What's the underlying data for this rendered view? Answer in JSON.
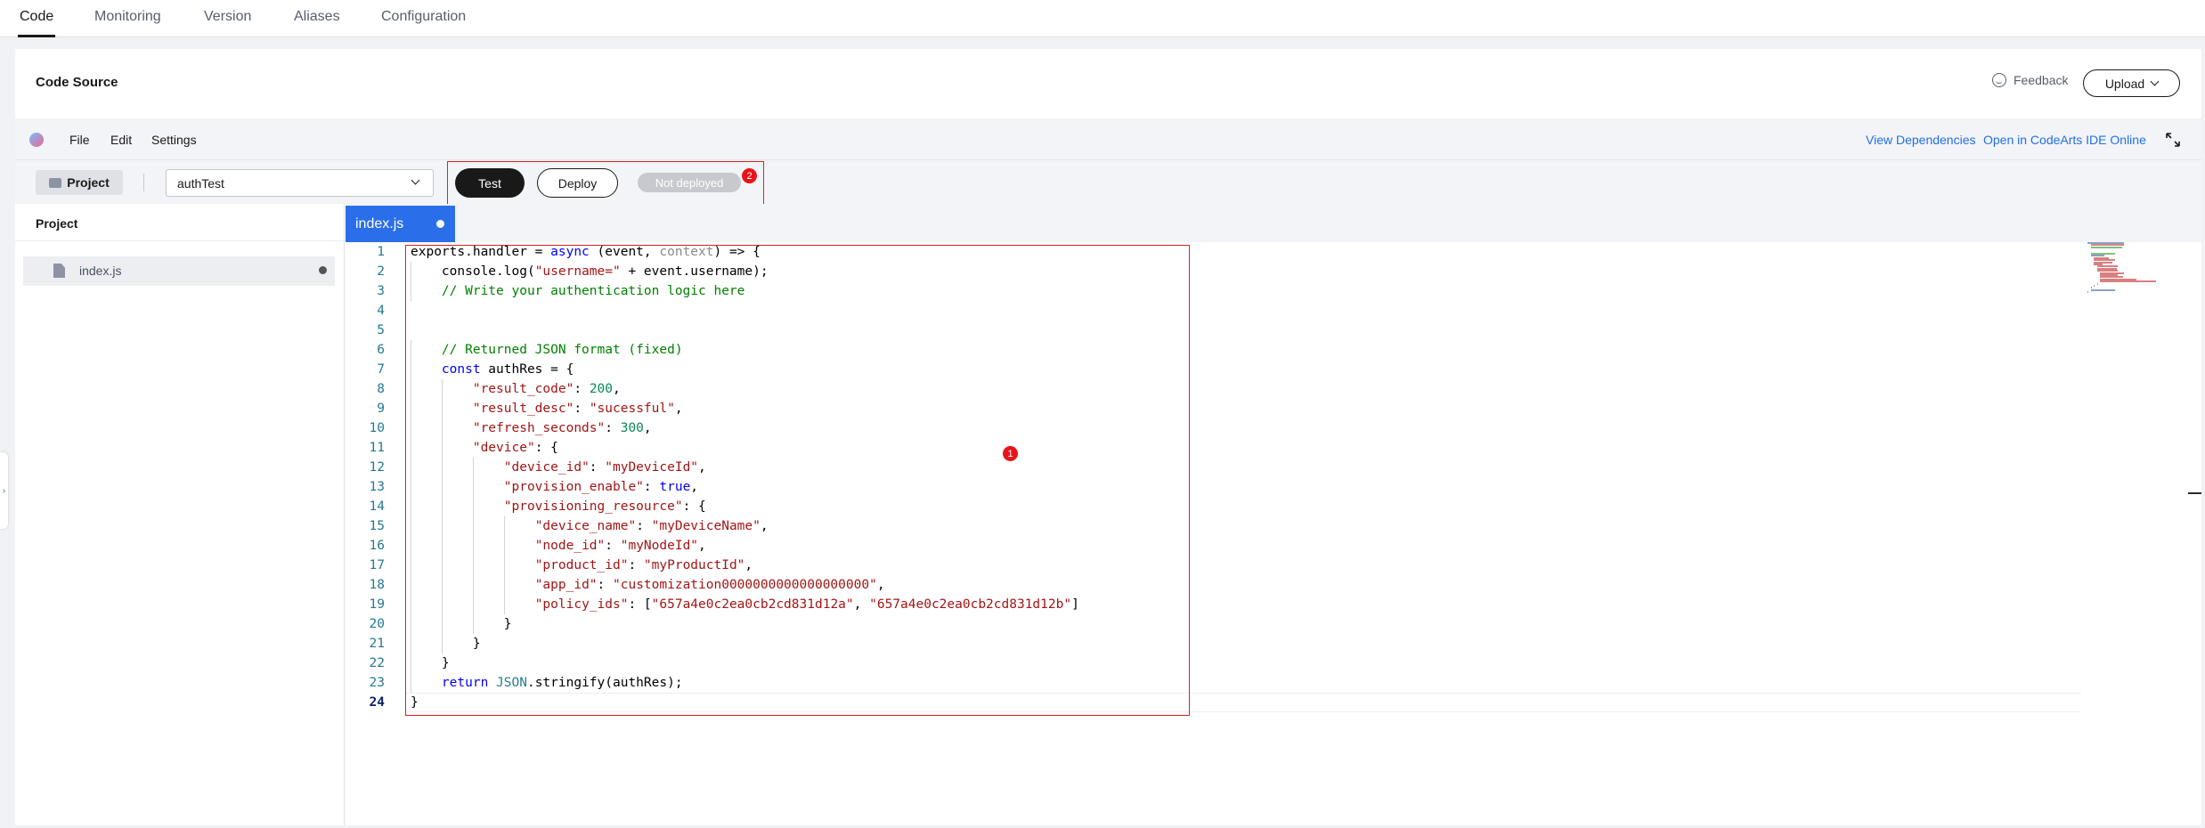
{
  "top_tabs": [
    "Code",
    "Monitoring",
    "Version",
    "Aliases",
    "Configuration"
  ],
  "active_tab": "Code",
  "card": {
    "title": "Code Source",
    "feedback_label": "Feedback",
    "upload_label": "Upload"
  },
  "menubar": {
    "items": [
      "File",
      "Edit",
      "Settings"
    ],
    "links": [
      "View Dependencies",
      "Open in CodeArts IDE Online"
    ]
  },
  "toolbar": {
    "project_label": "Project",
    "function_selected": "authTest",
    "test_label": "Test",
    "deploy_label": "Deploy",
    "status_label": "Not deployed"
  },
  "annotations": [
    "1",
    "2"
  ],
  "project_panel": {
    "title": "Project",
    "files": [
      "index.js"
    ]
  },
  "editor": {
    "tab_name": "index.js",
    "current_line": 24,
    "lines": [
      "exports.handler = async (event, context) => {",
      "    console.log(\"username=\" + event.username);",
      "    // Write your authentication logic here",
      "",
      "",
      "    // Returned JSON format (fixed)",
      "    const authRes = {",
      "        \"result_code\": 200,",
      "        \"result_desc\": \"sucessful\",",
      "        \"refresh_seconds\": 300,",
      "        \"device\": {",
      "            \"device_id\": \"myDeviceId\",",
      "            \"provision_enable\": true,",
      "            \"provisioning_resource\": {",
      "                \"device_name\": \"myDeviceName\",",
      "                \"node_id\": \"myNodeId\",",
      "                \"product_id\": \"myProductId\",",
      "                \"app_id\": \"customization0000000000000000000\",",
      "                \"policy_ids\": [\"657a4e0c2ea0cb2cd831d12a\", \"657a4e0c2ea0cb2cd831d12b\"]",
      "            }",
      "        }",
      "    }",
      "    return JSON.stringify(authRes);",
      "}"
    ]
  },
  "colors": {
    "accent": "#2a6eea",
    "primary_button": "#191919",
    "highlight": "#e02020",
    "badge": "#e8141b",
    "link": "#1f6feb"
  }
}
